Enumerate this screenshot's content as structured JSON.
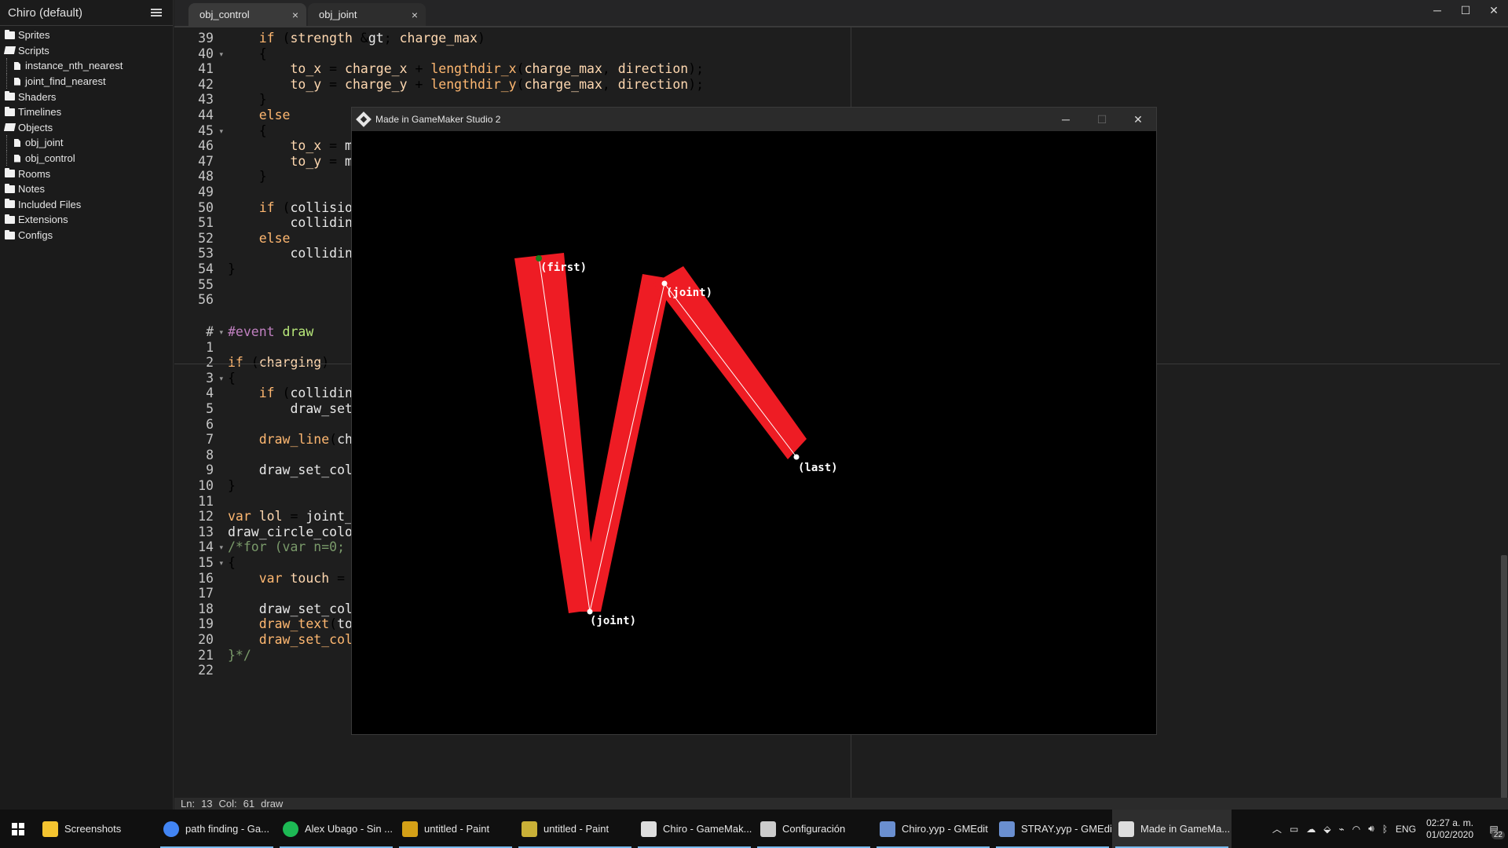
{
  "sidebar": {
    "project_title": "Chiro (default)",
    "items": [
      {
        "label": "Sprites",
        "type": "folder"
      },
      {
        "label": "Scripts",
        "type": "folder-open"
      },
      {
        "label": "instance_nth_nearest",
        "type": "file"
      },
      {
        "label": "joint_find_nearest",
        "type": "file"
      },
      {
        "label": "Shaders",
        "type": "folder"
      },
      {
        "label": "Timelines",
        "type": "folder"
      },
      {
        "label": "Objects",
        "type": "folder-open"
      },
      {
        "label": "obj_joint",
        "type": "file"
      },
      {
        "label": "obj_control",
        "type": "file"
      },
      {
        "label": "Rooms",
        "type": "folder"
      },
      {
        "label": "Notes",
        "type": "folder"
      },
      {
        "label": "Included Files",
        "type": "folder"
      },
      {
        "label": "Extensions",
        "type": "folder"
      },
      {
        "label": "Configs",
        "type": "folder"
      }
    ]
  },
  "tabs": [
    {
      "label": "obj_control",
      "close": "×"
    },
    {
      "label": "obj_joint",
      "close": "×"
    }
  ],
  "window_controls": {
    "minimize": "─",
    "maximize": "☐",
    "close": "✕"
  },
  "editor": {
    "lines_top": [
      {
        "n": "39",
        "fold": "",
        "t": "    if (strength > charge_max)"
      },
      {
        "n": "40",
        "fold": "▾",
        "t": "    {"
      },
      {
        "n": "41",
        "fold": "",
        "t": "        to_x = charge_x + lengthdir_x(charge_max, direction);"
      },
      {
        "n": "42",
        "fold": "",
        "t": "        to_y = charge_y + lengthdir_y(charge_max, direction);"
      },
      {
        "n": "43",
        "fold": "",
        "t": "    }"
      },
      {
        "n": "44",
        "fold": "",
        "t": "    else"
      },
      {
        "n": "45",
        "fold": "▾",
        "t": "    {"
      },
      {
        "n": "46",
        "fold": "",
        "t": "        to_x = m"
      },
      {
        "n": "47",
        "fold": "",
        "t": "        to_y = m"
      },
      {
        "n": "48",
        "fold": "",
        "t": "    }"
      },
      {
        "n": "49",
        "fold": "",
        "t": ""
      },
      {
        "n": "50",
        "fold": "",
        "t": "    if (collisio"
      },
      {
        "n": "51",
        "fold": "",
        "t": "        collidin"
      },
      {
        "n": "52",
        "fold": "",
        "t": "    else"
      },
      {
        "n": "53",
        "fold": "",
        "t": "        collidin"
      },
      {
        "n": "54",
        "fold": "",
        "t": "}"
      },
      {
        "n": "55",
        "fold": "",
        "t": ""
      },
      {
        "n": "56",
        "fold": "",
        "t": ""
      }
    ],
    "lines_bottom": [
      {
        "n": "#",
        "fold": "▾",
        "t": "#event draw"
      },
      {
        "n": "1",
        "fold": "",
        "t": ""
      },
      {
        "n": "2",
        "fold": "",
        "t": "if (charging)"
      },
      {
        "n": "3",
        "fold": "▾",
        "t": "{"
      },
      {
        "n": "4",
        "fold": "",
        "t": "    if (collidin"
      },
      {
        "n": "5",
        "fold": "",
        "t": "        draw_set"
      },
      {
        "n": "6",
        "fold": "",
        "t": ""
      },
      {
        "n": "7",
        "fold": "",
        "t": "    draw_line(ch"
      },
      {
        "n": "8",
        "fold": "",
        "t": ""
      },
      {
        "n": "9",
        "fold": "",
        "t": "    draw_set_col"
      },
      {
        "n": "10",
        "fold": "",
        "t": "}"
      },
      {
        "n": "11",
        "fold": "",
        "t": ""
      },
      {
        "n": "12",
        "fold": "",
        "t": "var lol = joint_"
      },
      {
        "n": "13",
        "fold": "",
        "t": "draw_circle_colo"
      },
      {
        "n": "14",
        "fold": "▾",
        "t": "/*for (var n=0;"
      },
      {
        "n": "15",
        "fold": "▾",
        "t": "{"
      },
      {
        "n": "16",
        "fold": "",
        "t": "    var touch ="
      },
      {
        "n": "17",
        "fold": "",
        "t": ""
      },
      {
        "n": "18",
        "fold": "",
        "t": "    draw_set_col"
      },
      {
        "n": "19",
        "fold": "",
        "t": "    draw_text(to"
      },
      {
        "n": "20",
        "fold": "",
        "t": "    draw_set_color(c_white)"
      },
      {
        "n": "21",
        "fold": "",
        "t": "}*/"
      },
      {
        "n": "22",
        "fold": "",
        "t": ""
      }
    ]
  },
  "status": {
    "ln_label": "Ln:",
    "ln": "13",
    "col_label": "Col:",
    "col": "61",
    "mode": "draw"
  },
  "game_window": {
    "title": "Made in GameMaker Studio 2",
    "minimize": "─",
    "maximize": "☐",
    "close": "✕",
    "labels": {
      "first": "(first)",
      "joint1": "(joint)",
      "joint2": "(joint)",
      "last": "(last)"
    },
    "colors": {
      "limb": "#ee1c24",
      "bone_line": "#ffffff",
      "start_point": "#1a7a1a",
      "background": "#000000"
    }
  },
  "taskbar": {
    "apps": [
      {
        "label": "Screenshots",
        "icon": "folder-icon",
        "color": "#f4c430",
        "open": false,
        "active": false
      },
      {
        "label": "path finding - Ga...",
        "icon": "chrome-icon",
        "color": "#4285f4",
        "open": true,
        "active": false
      },
      {
        "label": "Alex Ubago - Sin ...",
        "icon": "spotify-icon",
        "color": "#1db954",
        "open": true,
        "active": false
      },
      {
        "label": "untitled - Paint",
        "icon": "paint-icon",
        "color": "#d4a017",
        "open": true,
        "active": false
      },
      {
        "label": "untitled - Paint",
        "icon": "paint-icon",
        "color": "#c9b037",
        "open": true,
        "active": false
      },
      {
        "label": "Chiro - GameMak...",
        "icon": "gamemaker-icon",
        "color": "#dddddd",
        "open": true,
        "active": false
      },
      {
        "label": "Configuración",
        "icon": "gear-icon",
        "color": "#cccccc",
        "open": true,
        "active": false
      },
      {
        "label": "Chiro.yyp - GMEdit",
        "icon": "gmedit-icon",
        "color": "#6a8fd0",
        "open": true,
        "active": false
      },
      {
        "label": "STRAY.yyp - GMEdit",
        "icon": "gmedit-icon",
        "color": "#6a8fd0",
        "open": true,
        "active": false
      },
      {
        "label": "Made in GameMa...",
        "icon": "gamemaker-icon",
        "color": "#dddddd",
        "open": true,
        "active": true
      }
    ],
    "tray": {
      "language": "ENG",
      "time": "02:27 a. m.",
      "date": "01/02/2020",
      "notifications": "22"
    }
  }
}
